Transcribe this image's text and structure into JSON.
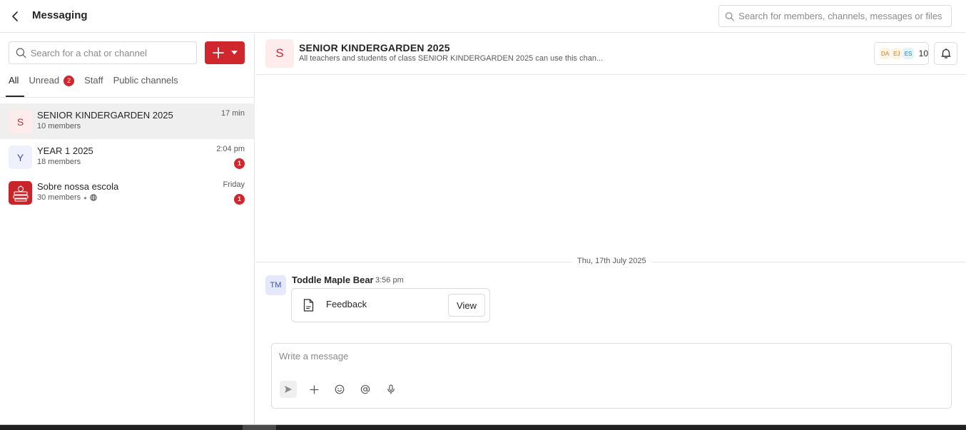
{
  "header": {
    "title": "Messaging",
    "back_icon": "chevron-left-icon",
    "search_placeholder": "Search for members, channels, messages or files"
  },
  "sidebar": {
    "search_placeholder": "Search for a chat or channel",
    "new_button_icon": "plus-icon",
    "tabs": [
      {
        "label": "All",
        "active": true
      },
      {
        "label": "Unread",
        "count": "2"
      },
      {
        "label": "Staff"
      },
      {
        "label": "Public channels"
      }
    ],
    "chats": [
      {
        "initial": "S",
        "name": "SENIOR KINDERGARDEN 2025",
        "members": "10 members",
        "time": "17 min",
        "selected": true,
        "avatar_bg": "#fdeceb",
        "avatar_color": "#d0272e"
      },
      {
        "initial": "Y",
        "name": "YEAR 1 2025",
        "members": "18 members",
        "time": "2:04 pm",
        "unread": "1",
        "avatar_bg": "#eef0fb",
        "avatar_color": "#3e4fa5"
      },
      {
        "initial": "",
        "name": "Sobre nossa escola",
        "members": "30 members",
        "time": "Friday",
        "unread": "1",
        "public": true,
        "avatar_bg": "#c8252b",
        "avatar_icon": "school-logo-icon"
      }
    ]
  },
  "channel": {
    "initial": "S",
    "title": "SENIOR KINDERGARDEN 2025",
    "description": "All teachers and students of class SENIOR KINDERGARDEN 2025 can use this chan...",
    "member_avatars": [
      {
        "text": "DA",
        "bg": "#fdf2e3",
        "color": "#c9821b"
      },
      {
        "text": "EJ",
        "bg": "#fdf2e3",
        "color": "#c9821b"
      },
      {
        "text": "ES",
        "bg": "#e3f3fa",
        "color": "#2c7ea4"
      }
    ],
    "member_count": "10",
    "bell_icon": "bell-icon"
  },
  "messages": {
    "date_label": "Thu, 17th July 2025",
    "items": [
      {
        "avatar": "TM",
        "author": "Toddle Maple Bear",
        "time": "3:56 pm",
        "attachment": {
          "icon": "document-icon",
          "name": "Feedback",
          "action": "View"
        }
      }
    ]
  },
  "composer": {
    "placeholder": "Write a message",
    "tools": [
      "send-icon",
      "plus-icon",
      "emoji-icon",
      "mention-icon",
      "microphone-icon"
    ]
  },
  "colors": {
    "accent": "#d0272e",
    "border": "#e6e6e6",
    "selected_row": "#efefef"
  }
}
